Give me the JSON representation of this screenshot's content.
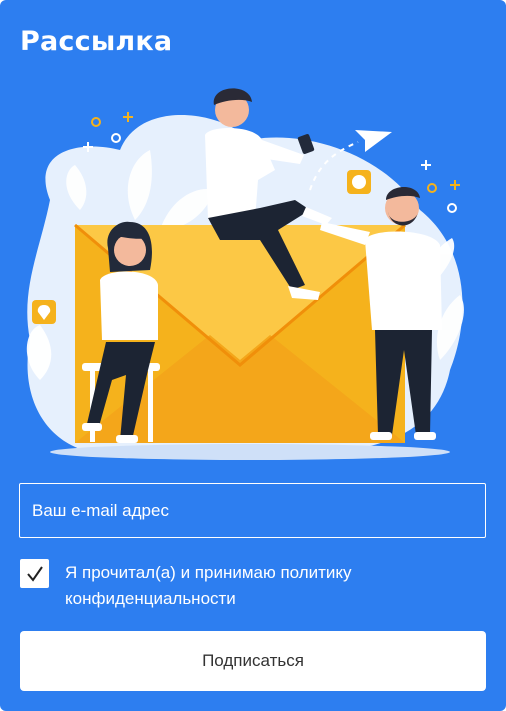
{
  "widget": {
    "title": "Рассылка",
    "accent_color": "#2d7ef0"
  },
  "illustration": {
    "icons": [
      "location-pin-icon",
      "user-badge-icon",
      "paper-plane-icon",
      "sparkle-icon"
    ]
  },
  "form": {
    "email_placeholder": "Ваш e-mail адрес",
    "email_value": "",
    "consent_checked": true,
    "consent_text": "Я прочитал(а) и принимаю политику конфиденциальности",
    "submit_label": "Подписаться"
  }
}
